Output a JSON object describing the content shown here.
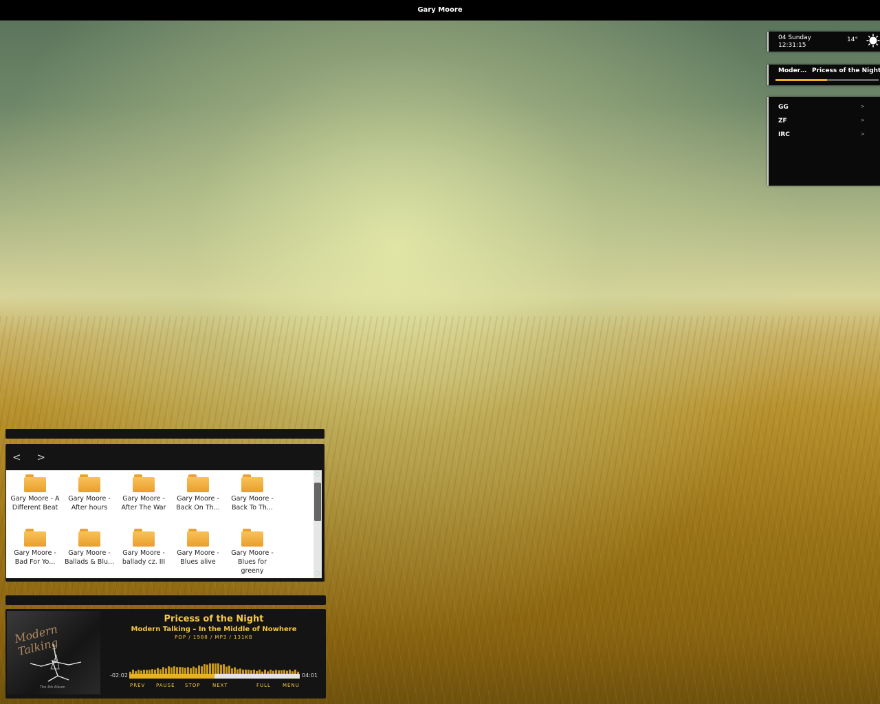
{
  "window": {
    "title": "Gary Moore"
  },
  "clock": {
    "date": "04 Sunday",
    "time": "12:31:15",
    "temperature": "14°",
    "weather_icon": "sun-icon"
  },
  "now_playing_mini": {
    "artist": "Moder…",
    "title": "Pricess of the Night",
    "progress": 0.5
  },
  "chats": {
    "items": [
      {
        "label": "GG",
        "arrow": ">"
      },
      {
        "label": "ZF",
        "arrow": ">"
      },
      {
        "label": "IRC",
        "arrow": ">"
      }
    ]
  },
  "file_manager": {
    "nav": {
      "back": "<",
      "forward": ">"
    },
    "folders": [
      {
        "line1": "Gary Moore - A",
        "line2": "Different Beat"
      },
      {
        "line1": "Gary Moore -",
        "line2": "After hours"
      },
      {
        "line1": "Gary Moore -",
        "line2": "After The War"
      },
      {
        "line1": "Gary Moore -",
        "line2": "Back On Th..."
      },
      {
        "line1": "Gary Moore -",
        "line2": "Back To Th..."
      },
      {
        "line1": "Gary Moore -",
        "line2": "Bad For Yo..."
      },
      {
        "line1": "Gary Moore -",
        "line2": "Ballads & Blu..."
      },
      {
        "line1": "Gary Moore -",
        "line2": "ballady cz. III"
      },
      {
        "line1": "Gary Moore -",
        "line2": "Blues alive"
      },
      {
        "line1": "Gary Moore -",
        "line2": "Blues for greeny"
      }
    ]
  },
  "player": {
    "song": "Pricess of the Night",
    "artist_album": "Modern Talking – In the Middle of Nowhere",
    "meta": "POP / 1988 / MP3 / 131KB",
    "elapsed": "-02:02",
    "total": "04:01",
    "progress": 0.5,
    "cover": {
      "title": "Modern Talking",
      "subtitle": "The 4th Album"
    },
    "controls": {
      "prev": "PREV",
      "pause": "PAUSE",
      "stop": "STOP",
      "next": "NEXT",
      "full": "FULL",
      "menu": "MENU"
    },
    "accent": "#f6c844"
  }
}
